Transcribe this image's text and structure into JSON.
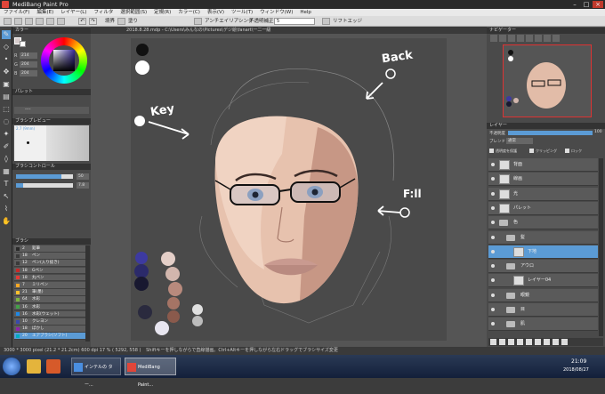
{
  "window": {
    "title": "MediBang Paint Pro"
  },
  "menu": [
    "ファイル(F)",
    "編集(E)",
    "レイヤー(L)",
    "フィルタ",
    "選択範囲(S)",
    "定規(R)",
    "カラー(C)",
    "表示(V)",
    "ツール(T)",
    "ウィンドウ(W)",
    "Help"
  ],
  "toolbar": {
    "mode_label": "境界",
    "fill_label": "塗り",
    "antialias_label": "アンチエイリアシング",
    "width_label": "不透明補正",
    "width_value": "5",
    "checkbox_label": "リフトエッジ"
  },
  "tab": {
    "label": "2018.8.28.mdp - C:\\Users\\みんなの\\Pictures\\デジ絵\\fanart\\一二一級"
  },
  "color_panel": {
    "title": "カラー",
    "r": "214",
    "g": "204",
    "b": "204"
  },
  "palette_panel": {
    "title": "パレット",
    "value": "----"
  },
  "brush_preview": {
    "title": "ブラシプレビュー",
    "size": "2.7 (9mm)"
  },
  "brush_control": {
    "title": "ブラシコントロール",
    "size": "50",
    "opacity": "7.8"
  },
  "brush_panel": {
    "title": "ブラシ",
    "items": [
      {
        "size": "2",
        "name": "鉛筆",
        "color": "#2a2a2a"
      },
      {
        "size": "18",
        "name": "ペン",
        "color": "#3a3a3a"
      },
      {
        "size": "12",
        "name": "ペン(入り抜き)",
        "color": "#3a3a3a"
      },
      {
        "size": "18",
        "name": "Gペン",
        "color": "#c62828"
      },
      {
        "size": "18",
        "name": "丸ペン",
        "color": "#e53935"
      },
      {
        "size": "7",
        "name": "ミリペン",
        "color": "#f9a825"
      },
      {
        "size": "21",
        "name": "筆(墨)",
        "color": "#fbc02d"
      },
      {
        "size": "64",
        "name": "水彩",
        "color": "#7cb342"
      },
      {
        "size": "16",
        "name": "水彩",
        "color": "#43a047"
      },
      {
        "size": "16",
        "name": "水彩(ウェット)",
        "color": "#1e88e5"
      },
      {
        "size": "10",
        "name": "クレヨン",
        "color": "#3949ab"
      },
      {
        "size": "18",
        "name": "ぼかし",
        "color": "#8e24aa"
      },
      {
        "size": "20",
        "name": "エアブラシ(ソフト)",
        "color": "#00acc1"
      }
    ]
  },
  "navigator": {
    "title": "ナビゲーター"
  },
  "layer_panel": {
    "title": "レイヤー",
    "opacity_label": "不透明度",
    "opacity_value": "100",
    "blend_label": "ブレンド",
    "blend_value": "通常",
    "opt1": "透明度を保護",
    "opt2": "クリッピング",
    "opt3": "ロック",
    "layers": [
      {
        "name": "背面",
        "type": "layer",
        "indent": 0
      },
      {
        "name": "線画",
        "type": "layer",
        "indent": 0
      },
      {
        "name": "光",
        "type": "layer",
        "indent": 0
      },
      {
        "name": "パレット",
        "type": "layer",
        "indent": 0
      },
      {
        "name": "色",
        "type": "folder",
        "indent": 0
      },
      {
        "name": "髪",
        "type": "folder",
        "indent": 1
      },
      {
        "name": "下地",
        "type": "layer",
        "indent": 2,
        "selected": true
      },
      {
        "name": "アウロ",
        "type": "folder",
        "indent": 1
      },
      {
        "name": "レイヤー04",
        "type": "layer",
        "indent": 2
      },
      {
        "name": "眼鏡",
        "type": "folder",
        "indent": 1
      },
      {
        "name": "目",
        "type": "folder",
        "indent": 1
      },
      {
        "name": "肌",
        "type": "folder",
        "indent": 1
      }
    ]
  },
  "canvas": {
    "annot_back": "Back",
    "annot_key": "Key",
    "annot_fill": "F:ll"
  },
  "status": {
    "size": "3000 * 3000 pixel",
    "dims": "(21.2 * 21.2cm)",
    "dpi": "600 dpi",
    "zoom": "17 %",
    "coords": "( 5292, 558 )",
    "hint": "Shiftキーを押しながらで直線描画。Ctrl+Altキーを押しながら左右ドラッグでブラシサイズ変更"
  },
  "taskbar": {
    "task1": "インテルの ター...",
    "task2": "MediBang Paint...",
    "time": "21:09",
    "date": "2018/08/27"
  },
  "colors": {
    "accent": "#5b9bd5",
    "selected_layer": "#5b9bd5"
  }
}
